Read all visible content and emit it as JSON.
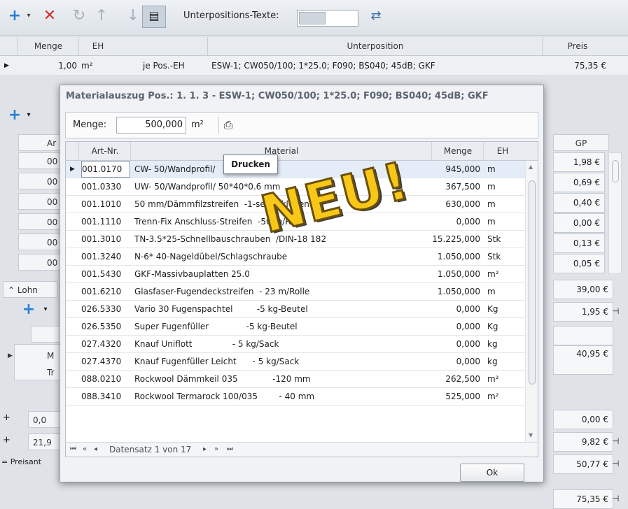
{
  "toolbar": {
    "icons": [
      "add-icon",
      "dropdown-icon",
      "delete-icon",
      "undo-icon",
      "arrow-up-icon",
      "arrow-down-icon",
      "text-toggle-icon",
      "translate-icon"
    ],
    "label": "Unterpositions-Texte:"
  },
  "top_grid": {
    "headers": {
      "menge": "Menge",
      "eh": "EH",
      "unterposition": "Unterposition",
      "preis": "Preis"
    },
    "row": {
      "menge": "1,00",
      "eh": "m²",
      "basis": "je Pos.-EH",
      "unterposition": "ESW-1; CW050/100; 1*25.0; F090; BS040; 45dB; GKF",
      "preis": "75,35 €"
    }
  },
  "background": {
    "col_ar": "Ar",
    "codes": [
      "00",
      "00",
      "00",
      "00",
      "00",
      "00"
    ],
    "gp_header": "GP",
    "gp_values": [
      "1,98 €",
      "0,69 €",
      "0,40 €",
      "0,00 €",
      "0,13 €",
      "0,05 €"
    ],
    "lohn_label": "Lohn",
    "lohn_value": "39,00 €",
    "lohn_sub_value": "1,95 €",
    "m_label": "M",
    "tr_label": "Tr",
    "m_value": "40,95 €",
    "plus1": "0,0",
    "plus1_value": "0,00 €",
    "plus2": "21,9",
    "plus2_value": "9,82 €",
    "preisant_label": "= Preisant",
    "preisant_value": "50,77 €",
    "total_value": "75,35 €"
  },
  "dialog": {
    "title": "Materialauszug Pos.: 1. 1.  3  -  ESW-1; CW050/100; 1*25.0; F090; BS040; 45dB; GKF",
    "menge_label": "Menge:",
    "menge_value": "500,000",
    "menge_unit": "m²",
    "tooltip": "Drucken",
    "columns": {
      "artnr": "Art-Nr.",
      "material": "Material",
      "menge": "Menge",
      "eh": "EH"
    },
    "rows": [
      {
        "artnr": "001.0170",
        "material": "CW- 50/Wandprofil/",
        "material_tail": "m",
        "menge": "945,000",
        "eh": "m"
      },
      {
        "artnr": "001.0330",
        "material": "UW- 50/Wandprofil/ 50*40*0.6 mm",
        "menge": "367,500",
        "eh": "m"
      },
      {
        "artnr": "001.1010",
        "material": "50 mm/Dämmfilzstreifen  -1-seitig klebend",
        "menge": "630,000",
        "eh": "m"
      },
      {
        "artnr": "001.1110",
        "material": "Trenn-Fix Anschluss-Streifen  -50 m/Rolle",
        "menge": "0,000",
        "eh": "m"
      },
      {
        "artnr": "001.3010",
        "material": "TN-3.5*25-Schnellbauschrauben  /DIN-18 182",
        "menge": "15.225,000",
        "eh": "Stk"
      },
      {
        "artnr": "001.3240",
        "material": "N-6* 40-Nageldübel/Schlagschraube",
        "menge": "1.050,000",
        "eh": "Stk"
      },
      {
        "artnr": "001.5430",
        "material": "GKF-Massivbauplatten 25.0",
        "menge": "1.050,000",
        "eh": "m²"
      },
      {
        "artnr": "001.6210",
        "material": "Glasfaser-Fugendeckstreifen  - 23 m/Rolle",
        "menge": "1.050,000",
        "eh": "m"
      },
      {
        "artnr": "026.5330",
        "material": "Vario 30 Fugenspachtel         -5 kg-Beutel",
        "menge": "0,000",
        "eh": "Kg"
      },
      {
        "artnr": "026.5350",
        "material": "Super Fugenfüller              -5 kg-Beutel",
        "menge": "0,000",
        "eh": "Kg"
      },
      {
        "artnr": "027.4320",
        "material": "Knauf Uniflott               - 5 kg/Sack",
        "menge": "0,000",
        "eh": "kg"
      },
      {
        "artnr": "027.4370",
        "material": "Knauf Fugenfüller Leicht      - 5 kg/Sack",
        "menge": "0,000",
        "eh": "kg"
      },
      {
        "artnr": "088.0210",
        "material": "Rockwool Dämmkeil 035             -120 mm",
        "menge": "262,500",
        "eh": "m²"
      },
      {
        "artnr": "088.3410",
        "material": "Rockwool Termarock 100/035        - 40 mm",
        "menge": "525,000",
        "eh": "m²"
      }
    ],
    "pager": "Datensatz 1 von 17",
    "ok": "Ok"
  },
  "stamp": "NEU!",
  "colors": {
    "accent_blue": "#2a7fd4",
    "delete_red": "#d22f2f",
    "stamp_yellow": "#f7c818"
  }
}
